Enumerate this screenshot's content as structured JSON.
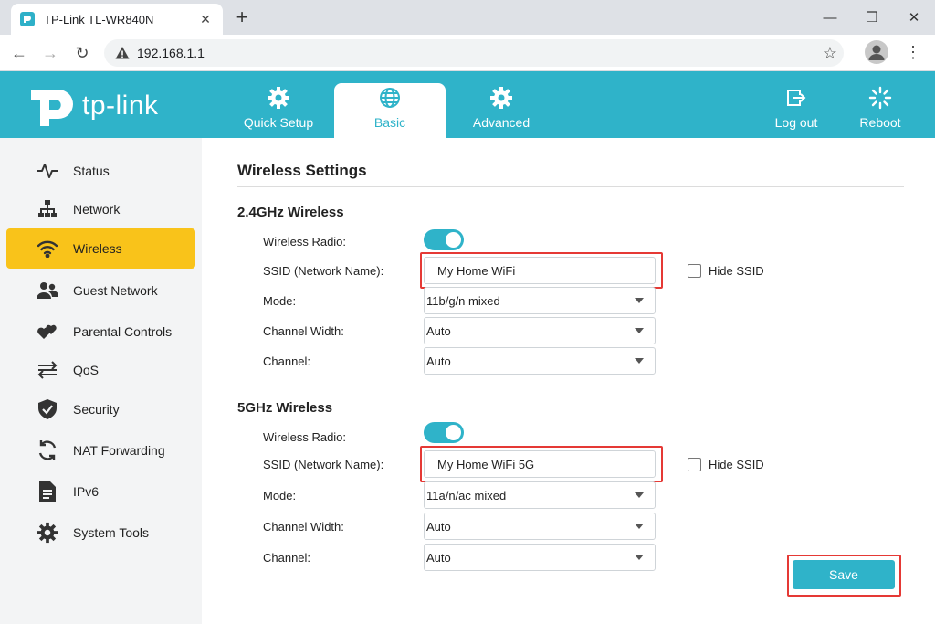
{
  "browser": {
    "tab_title": "TP-Link TL-WR840N",
    "close_glyph": "✕",
    "new_tab_glyph": "+",
    "url": "192.168.1.1",
    "minimize_glyph": "—",
    "restore_glyph": "❐",
    "close_window_glyph": "✕",
    "back_glyph": "←",
    "forward_glyph": "→",
    "reload_glyph": "↻",
    "star_glyph": "☆",
    "menu_glyph": "⋮"
  },
  "header": {
    "logo_text": "tp-link",
    "nav": {
      "quick_setup": "Quick Setup",
      "basic": "Basic",
      "advanced": "Advanced",
      "logout": "Log out",
      "reboot": "Reboot"
    },
    "colors": {
      "brand": "#2fb3c9",
      "active_sidebar": "#f9c31a",
      "highlight": "#e53935"
    }
  },
  "sidebar": {
    "items": [
      {
        "label": "Status",
        "icon": "pulse-icon"
      },
      {
        "label": "Network",
        "icon": "network-icon"
      },
      {
        "label": "Wireless",
        "icon": "wifi-icon",
        "active": true
      },
      {
        "label": "Guest Network",
        "icon": "guests-icon"
      },
      {
        "label": "Parental Controls",
        "icon": "hearts-icon"
      },
      {
        "label": "QoS",
        "icon": "qos-arrows-icon"
      },
      {
        "label": "Security",
        "icon": "shield-icon"
      },
      {
        "label": "NAT Forwarding",
        "icon": "refresh-icon"
      },
      {
        "label": "IPv6",
        "icon": "document-icon"
      },
      {
        "label": "System Tools",
        "icon": "gear-icon"
      }
    ]
  },
  "main": {
    "title": "Wireless Settings",
    "save_label": "Save",
    "band24": {
      "title": "2.4GHz Wireless",
      "radio_label": "Wireless Radio:",
      "radio_on": true,
      "ssid_label": "SSID (Network Name):",
      "ssid_value": "My Home WiFi",
      "hide_ssid_label": "Hide SSID",
      "hide_ssid_checked": false,
      "mode_label": "Mode:",
      "mode_value": "11b/g/n mixed",
      "width_label": "Channel Width:",
      "width_value": "Auto",
      "channel_label": "Channel:",
      "channel_value": "Auto"
    },
    "band5": {
      "title": "5GHz Wireless",
      "radio_label": "Wireless Radio:",
      "radio_on": true,
      "ssid_label": "SSID (Network Name):",
      "ssid_value": "My Home WiFi 5G",
      "hide_ssid_label": "Hide SSID",
      "hide_ssid_checked": false,
      "mode_label": "Mode:",
      "mode_value": "11a/n/ac mixed",
      "width_label": "Channel Width:",
      "width_value": "Auto",
      "channel_label": "Channel:",
      "channel_value": "Auto"
    }
  }
}
